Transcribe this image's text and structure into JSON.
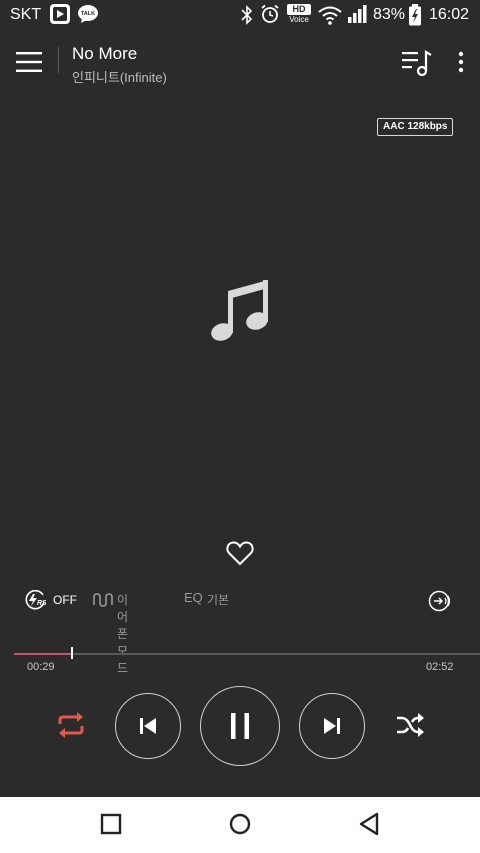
{
  "status_bar": {
    "carrier": "SKT",
    "app_icons": [
      "play-icon",
      "kakaotalk-icon"
    ],
    "talk_badge": "TALK",
    "hd_voice_top": "HD",
    "hd_voice_bottom": "Voice",
    "battery": "83%",
    "time": "16:02",
    "icons": [
      "bluetooth-icon",
      "alarm-icon",
      "hd-voice-icon",
      "wifi-icon",
      "signal-icon",
      "battery-icon"
    ]
  },
  "now_playing": {
    "title": "No More",
    "artist": "인피니트(Infinite)",
    "bitrate": "AAC 128kbps"
  },
  "audio_options": {
    "rs_state": "OFF",
    "rs_badge": "RS",
    "earphone_mode": "이어폰 모드",
    "eq_label": "EQ",
    "eq_mode": "기본"
  },
  "progress": {
    "current": "00:29",
    "total": "02:52",
    "fraction": 0.17
  },
  "controls": {
    "repeat_color": "#e5564b",
    "state": "playing"
  },
  "colors": {
    "background": "#2b2b2b",
    "accent": "#c6546a",
    "navbar": "#ffffff"
  }
}
